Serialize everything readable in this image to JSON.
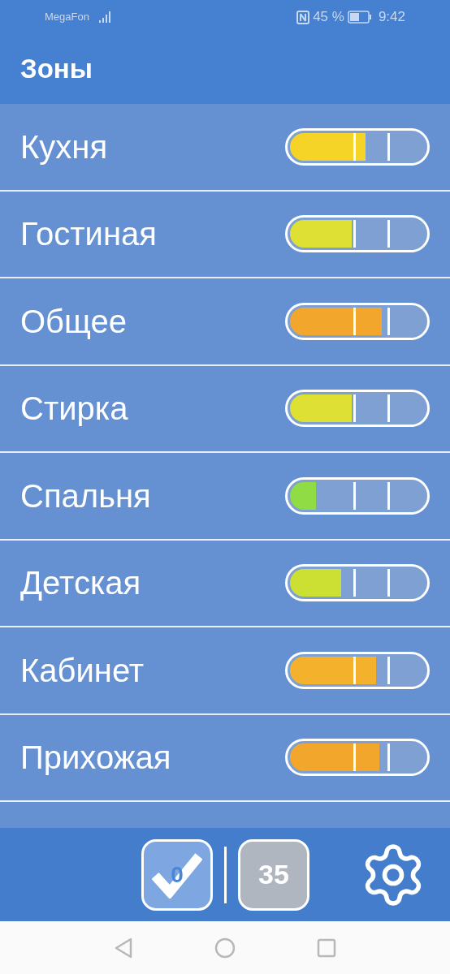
{
  "status_bar": {
    "carrier": "MegaFon",
    "battery": "45 %",
    "time": "9:42"
  },
  "header": {
    "title": "Зоны"
  },
  "zones": [
    {
      "name": "Кухня",
      "level": 0.56,
      "color": "#f5d327"
    },
    {
      "name": "Гостиная",
      "level": 0.46,
      "color": "#dee033"
    },
    {
      "name": "Общее",
      "level": 0.68,
      "color": "#f2a72c"
    },
    {
      "name": "Стирка",
      "level": 0.46,
      "color": "#dee033"
    },
    {
      "name": "Спальня",
      "level": 0.19,
      "color": "#8fdc45"
    },
    {
      "name": "Детская",
      "level": 0.38,
      "color": "#cce033"
    },
    {
      "name": "Кабинет",
      "level": 0.64,
      "color": "#f4b22c"
    },
    {
      "name": "Прихожая",
      "level": 0.66,
      "color": "#f2a72c"
    }
  ],
  "toolbar": {
    "done_count": "0",
    "pending_count": "35"
  }
}
